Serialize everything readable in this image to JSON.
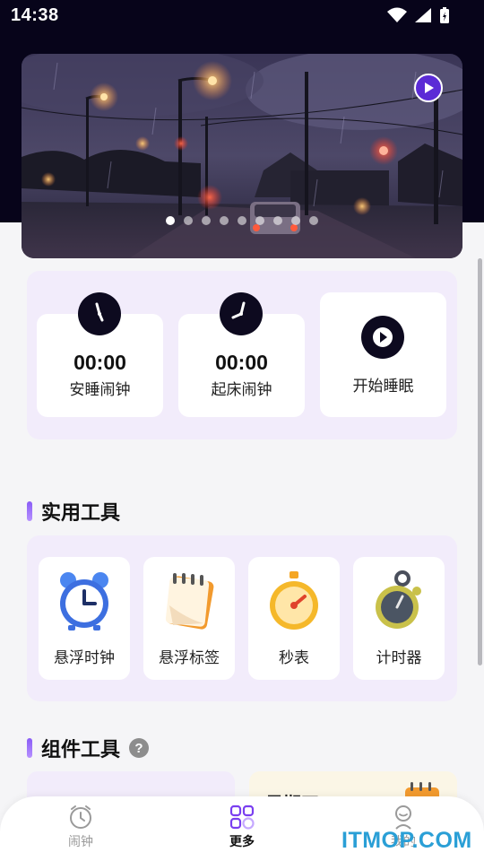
{
  "status_bar": {
    "time": "14:38"
  },
  "banner": {
    "slide_count": 9,
    "active_index": 0
  },
  "alarm": {
    "sleep": {
      "time": "00:00",
      "label": "安睡闹钟"
    },
    "wake": {
      "time": "00:00",
      "label": "起床闹钟"
    },
    "start": {
      "label": "开始睡眠"
    }
  },
  "tools_section": {
    "title": "实用工具",
    "items": [
      {
        "label": "悬浮时钟",
        "icon": "alarm-clock-icon"
      },
      {
        "label": "悬浮标签",
        "icon": "notepad-icon"
      },
      {
        "label": "秒表",
        "icon": "stopwatch-icon"
      },
      {
        "label": "计时器",
        "icon": "timer-icon"
      }
    ]
  },
  "widgets_section": {
    "title": "组件工具",
    "help": "?",
    "peek_text": "星期四"
  },
  "nav": {
    "items": [
      {
        "label": "闹钟",
        "icon": "alarm-icon",
        "active": false
      },
      {
        "label": "更多",
        "icon": "grid-icon",
        "active": true
      },
      {
        "label": "我的",
        "icon": "user-icon",
        "active": false
      }
    ]
  },
  "watermark": "ITMOP.COM",
  "colors": {
    "accent": "#8a5cf6",
    "card_bg": "#f2ecfb",
    "dark": "#07041a"
  }
}
